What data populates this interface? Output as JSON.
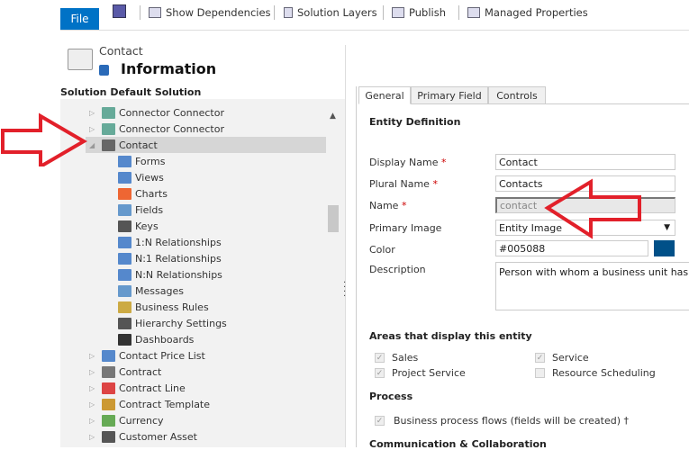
{
  "toolbar": {
    "file": "File",
    "show_dependencies": "Show Dependencies",
    "solution_layers": "Solution Layers",
    "publish": "Publish",
    "managed_properties": "Managed Properties"
  },
  "header": {
    "entity": "Contact",
    "title": "Information"
  },
  "tree": {
    "title": "Solution Default Solution",
    "items": [
      "Connector Connector",
      "Connector Connector",
      "Contact"
    ],
    "children": [
      "Forms",
      "Views",
      "Charts",
      "Fields",
      "Keys",
      "1:N Relationships",
      "N:1 Relationships",
      "N:N Relationships",
      "Messages",
      "Business Rules",
      "Hierarchy Settings",
      "Dashboards"
    ],
    "after": [
      "Contact Price List",
      "Contract",
      "Contract Line",
      "Contract Template",
      "Currency",
      "Customer Asset"
    ]
  },
  "tabs": [
    "General",
    "Primary Field",
    "Controls"
  ],
  "form": {
    "section": "Entity Definition",
    "req": "*",
    "display_name_label": "Display Name",
    "display_name": "Contact",
    "plural_name_label": "Plural Name",
    "plural_name": "Contacts",
    "name_label": "Name",
    "name": "contact",
    "primary_image_label": "Primary Image",
    "primary_image": "Entity Image",
    "color_label": "Color",
    "color": "#005088",
    "description_label": "Description",
    "description": "Person with whom a business unit has a relationship"
  },
  "areas": {
    "title": "Areas that display this entity",
    "sales": "Sales",
    "service": "Service",
    "project_service": "Project Service",
    "resource_scheduling": "Resource Scheduling"
  },
  "process": {
    "title": "Process",
    "bpf": "Business process flows (fields will be created) †"
  },
  "comm": {
    "title": "Communication & Collaboration"
  }
}
